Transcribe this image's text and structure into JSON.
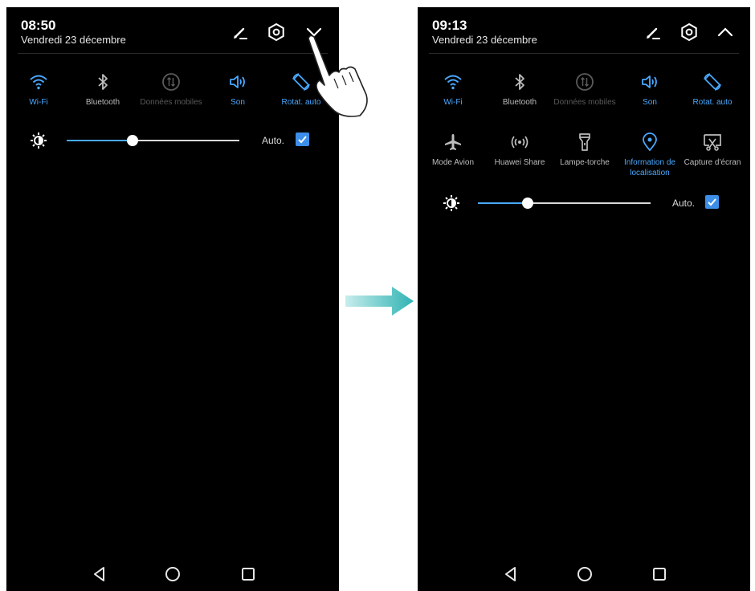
{
  "left_screen": {
    "time": "08:50",
    "date": "Vendredi 23 décembre",
    "header_icons": [
      "edit-icon",
      "settings-icon",
      "expand-chevron-icon"
    ],
    "tiles": [
      {
        "label": "Wi-Fi",
        "state": "on",
        "icon": "wifi-icon"
      },
      {
        "label": "Bluetooth",
        "state": "off",
        "icon": "bluetooth-icon"
      },
      {
        "label": "Données mobiles",
        "state": "disabled",
        "icon": "mobile-data-icon"
      },
      {
        "label": "Son",
        "state": "on",
        "icon": "sound-icon"
      },
      {
        "label": "Rotat. auto",
        "state": "on",
        "icon": "auto-rotate-icon"
      }
    ],
    "brightness": {
      "level": 0.38,
      "auto_label": "Auto.",
      "auto_checked": true
    }
  },
  "right_screen": {
    "time": "09:13",
    "date": "Vendredi 23 décembre",
    "header_icons": [
      "edit-icon",
      "settings-icon",
      "collapse-chevron-icon"
    ],
    "tiles": [
      {
        "label": "Wi-Fi",
        "state": "on",
        "icon": "wifi-icon"
      },
      {
        "label": "Bluetooth",
        "state": "off",
        "icon": "bluetooth-icon"
      },
      {
        "label": "Données mobiles",
        "state": "disabled",
        "icon": "mobile-data-icon"
      },
      {
        "label": "Son",
        "state": "on",
        "icon": "sound-icon"
      },
      {
        "label": "Rotat. auto",
        "state": "on",
        "icon": "auto-rotate-icon"
      },
      {
        "label": "Mode Avion",
        "state": "off",
        "icon": "airplane-icon"
      },
      {
        "label": "Huawei Share",
        "state": "off",
        "icon": "huawei-share-icon"
      },
      {
        "label": "Lampe-torche",
        "state": "off",
        "icon": "flashlight-icon"
      },
      {
        "label": "Information de localisation",
        "state": "on",
        "icon": "location-icon"
      },
      {
        "label": "Capture d'écran",
        "state": "off",
        "icon": "screenshot-icon"
      }
    ],
    "brightness": {
      "level": 0.29,
      "auto_label": "Auto.",
      "auto_checked": true
    }
  },
  "nav_bar": [
    "back-icon",
    "home-icon",
    "recents-icon"
  ],
  "colors": {
    "accent": "#4aa8ff",
    "background": "#000000",
    "transition_arrow": "#2fb3b3"
  }
}
